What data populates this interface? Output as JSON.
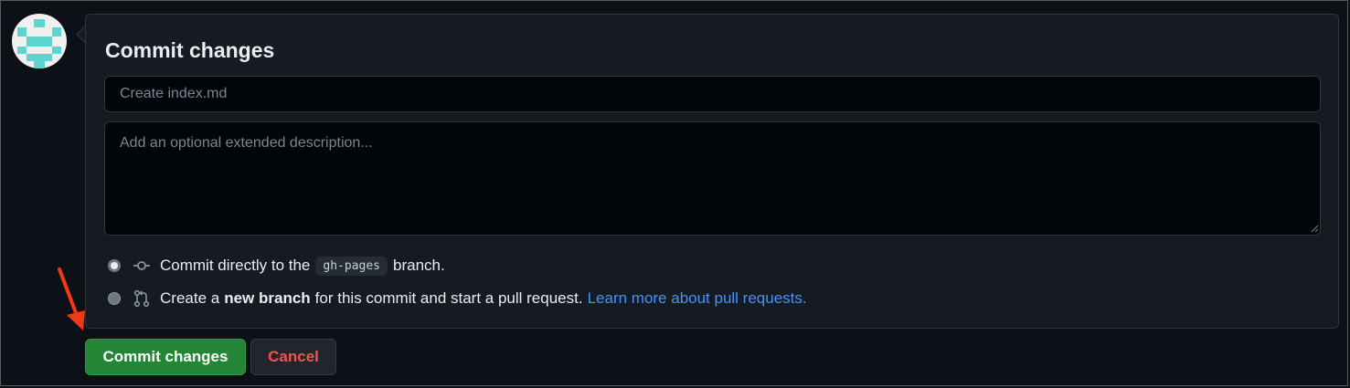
{
  "form": {
    "title": "Commit changes",
    "summary_placeholder": "Create index.md",
    "description_placeholder": "Add an optional extended description..."
  },
  "options": {
    "direct": {
      "text_before": "Commit directly to the",
      "branch": "gh-pages",
      "text_after": "branch.",
      "selected": true,
      "icon": "git-commit-icon"
    },
    "new_branch": {
      "text_before": "Create a",
      "bold": "new branch",
      "text_after": "for this commit and start a pull request.",
      "link": "Learn more about pull requests.",
      "selected": false,
      "icon": "git-pull-request-icon"
    }
  },
  "buttons": {
    "commit_label": "Commit changes",
    "cancel_label": "Cancel"
  },
  "colors": {
    "background": "#0d1117",
    "panel": "#161b22",
    "commit_green": "#238636",
    "cancel_red": "#f85149",
    "link_blue": "#4493f8",
    "annotation_arrow": "#f03a17"
  },
  "avatar": {
    "icon": "identicon-avatar"
  },
  "annotation": {
    "icon": "red-arrow-icon"
  }
}
